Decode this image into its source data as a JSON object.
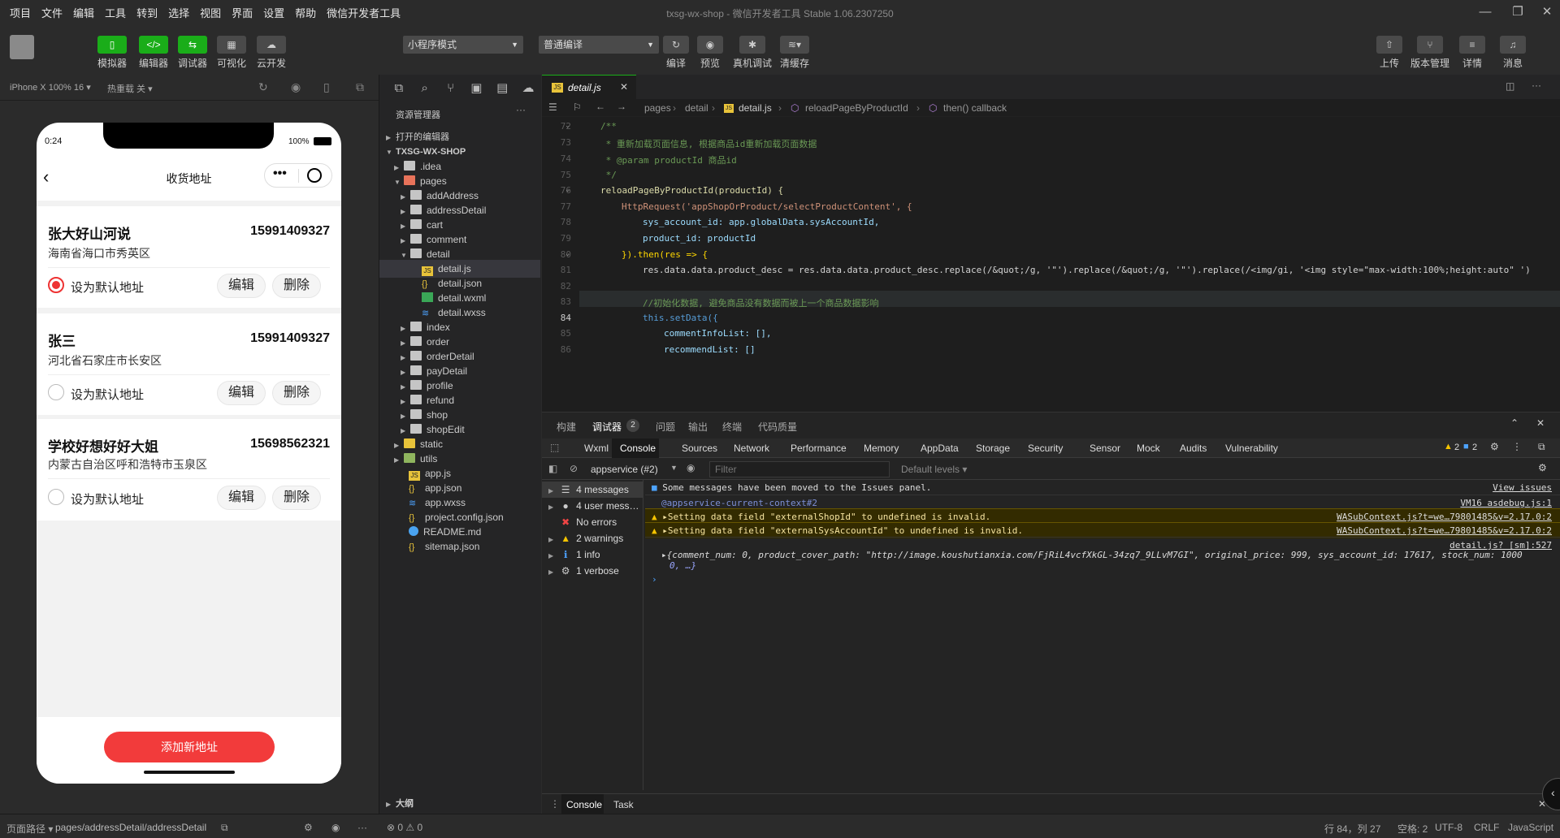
{
  "menu": {
    "items": [
      "项目",
      "文件",
      "编辑",
      "工具",
      "转到",
      "选择",
      "视图",
      "界面",
      "设置",
      "帮助",
      "微信开发者工具"
    ]
  },
  "window": {
    "title": "txsg-wx-shop - 微信开发者工具 Stable 1.06.2307250"
  },
  "toolbar": {
    "sim": "模拟器",
    "editor": "编辑器",
    "debugger": "调试器",
    "visual": "可视化",
    "cloud": "云开发",
    "mode": "小程序模式",
    "compile_mode": "普通编译",
    "compile": "编译",
    "preview": "预览",
    "realdebug": "真机调试",
    "clearcache": "清缓存",
    "upload": "上传",
    "version": "版本管理",
    "details": "详情",
    "messages": "消息"
  },
  "simulator": {
    "device": "iPhone X 100% 16",
    "hotreload": "热重载 关"
  },
  "phone": {
    "time": "0:24",
    "battery": "100%",
    "title": "收货地址",
    "addresses": [
      {
        "name": "张大好山河说",
        "phone": "15991409327",
        "addr": "海南省海口市秀英区",
        "default": true
      },
      {
        "name": "张三",
        "phone": "15991409327",
        "addr": "河北省石家庄市长安区",
        "default": false
      },
      {
        "name": "学校好想好好大姐",
        "phone": "15698562321",
        "addr": "内蒙古自治区呼和浩特市玉泉区",
        "default": false
      }
    ],
    "set_default": "设为默认地址",
    "edit": "编辑",
    "delete": "删除",
    "add": "添加新地址"
  },
  "explorer": {
    "title": "资源管理器",
    "open_editors": "打开的编辑器",
    "project": "TXSG-WX-SHOP",
    "outline": "大纲",
    "problems": "⊗ 0 ⚠ 0",
    "items": [
      ".idea",
      "pages",
      "addAddress",
      "addressDetail",
      "cart",
      "comment",
      "detail",
      "detail.js",
      "detail.json",
      "detail.wxml",
      "detail.wxss",
      "index",
      "order",
      "orderDetail",
      "payDetail",
      "profile",
      "refund",
      "shop",
      "shopEdit",
      "static",
      "utils",
      "app.js",
      "app.json",
      "app.wxss",
      "project.config.json",
      "README.md",
      "sitemap.json"
    ]
  },
  "editor": {
    "tab": "detail.js",
    "crumbs": [
      "pages",
      "detail",
      "detail.js",
      "reloadPageByProductId",
      "then() callback"
    ],
    "lines": [
      "72",
      "73",
      "74",
      "75",
      "76",
      "77",
      "78",
      "79",
      "80",
      "81",
      "82",
      "83",
      "84",
      "85",
      "86"
    ],
    "code": [
      "/**",
      " * 重新加载页面信息, 根据商品id重新加载页面数据",
      " * @param productId 商品id",
      " */",
      "reloadPageByProductId(productId) {",
      "HttpRequest('appShopOrProduct/selectProductContent', {",
      "sys_account_id: app.globalData.sysAccountId,",
      "product_id: productId",
      "}).then(res => {",
      "res.data.data.product_desc = res.data.data.product_desc.replace(/&quot;/g, '\"').replace(/&quot;/g, '\"').replace(/<img/gi, '<img style=\"max-width:100%;height:auto\" ')",
      "",
      "//初始化数据, 避免商品没有数据而被上一个商品数据影响",
      "this.setData({",
      "commentInfoList: [],",
      "recommendList: []"
    ]
  },
  "panel": {
    "tabs": [
      "构建",
      "调试器",
      "问题",
      "输出",
      "终端",
      "代码质量"
    ],
    "badge": "2"
  },
  "devtools": {
    "tabs": [
      "Wxml",
      "Console",
      "Sources",
      "Network",
      "Performance",
      "Memory",
      "AppData",
      "Storage",
      "Security",
      "Sensor",
      "Mock",
      "Audits",
      "Vulnerability"
    ],
    "warn_count": "2",
    "info_count": "2",
    "context": "appservice (#2)",
    "filter": "Filter",
    "levels": "Default levels"
  },
  "console": {
    "sidebar": [
      "4 messages",
      "4 user mess…",
      "No errors",
      "2 warnings",
      "1 info",
      "1 verbose"
    ],
    "moved": "Some messages have been moved to the Issues panel.",
    "view_issues": "View issues",
    "context_link": "@appservice-current-context#2",
    "vm_src": "VM16 asdebug.js:1",
    "warn1": "Setting data field \"externalShopId\" to undefined is invalid.",
    "warn2": "Setting data field \"externalSysAccountId\" to undefined is invalid.",
    "warn_src": "WASubContext.js?t=we…79801485&v=2.17.0:2",
    "log_src": "detail.js? [sm]:527",
    "log": "{comment_num: 0, product_cover_path: \"http://image.koushutianxia.com/FjRiL4vcfXkGL-34zq7_9LLvM7GI\", original_price: 999, sys_account_id: 17617, stock_num: 1000",
    "log2": "0, …}"
  },
  "drawer": {
    "tabs": [
      "Console",
      "Task"
    ]
  },
  "statusbar": {
    "path_label": "页面路径",
    "path": "pages/addressDetail/addressDetail",
    "pos": "行 84，列 27",
    "spaces": "空格: 2",
    "enc": "UTF-8",
    "eol": "CRLF",
    "lang": "JavaScript"
  }
}
